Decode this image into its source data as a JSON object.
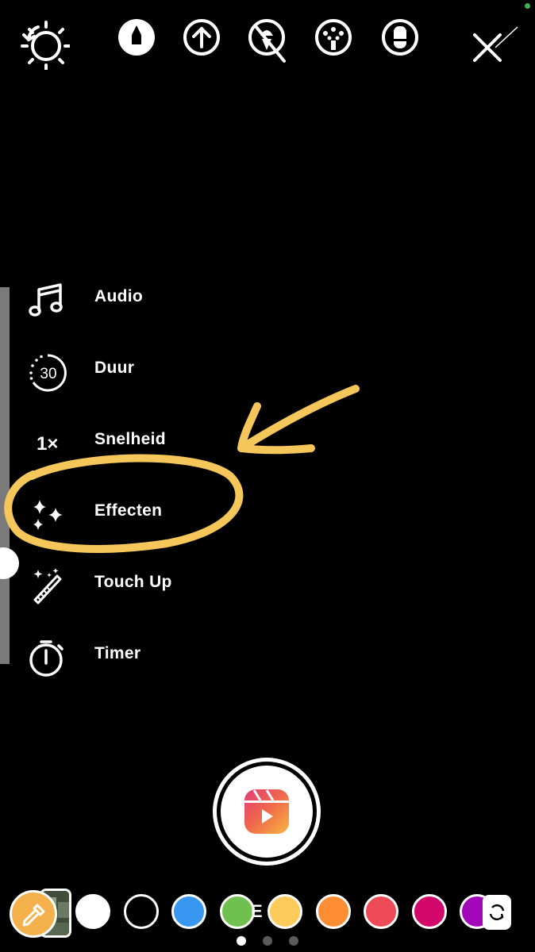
{
  "status": {
    "dot_color": "#3fb24a"
  },
  "toolbar": {
    "icons": [
      "rotate-gear-icon",
      "marker-pen-icon",
      "arrow-up-circle-icon",
      "ice-cream-crossed-icon",
      "chalk-brush-icon",
      "eraser-icon",
      "cross-lines-icon"
    ]
  },
  "menu": {
    "items": [
      {
        "icon": "music-note-icon",
        "label": "Audio"
      },
      {
        "icon": "timer-30-icon",
        "icon_text": "30",
        "label": "Duur"
      },
      {
        "icon": "speed-icon",
        "icon_text": "1×",
        "label": "Snelheid"
      },
      {
        "icon": "sparkles-icon",
        "label": "Effecten"
      },
      {
        "icon": "magic-wand-icon",
        "label": "Touch Up"
      },
      {
        "icon": "stopwatch-icon",
        "label": "Timer"
      }
    ]
  },
  "annotation": {
    "color": "#f5c65a"
  },
  "shutter": {
    "icon": "reels-icon"
  },
  "palette": {
    "eyedropper_color": "#f3b04b",
    "swatches": [
      "#ffffff",
      "#000000",
      "#3897f0",
      "#70c050",
      "#fdcb5c",
      "#fd8d32",
      "#ed4956",
      "#d10869",
      "#a307ba"
    ],
    "partial_text": "E"
  },
  "pager": {
    "count": 3,
    "active": 1
  }
}
